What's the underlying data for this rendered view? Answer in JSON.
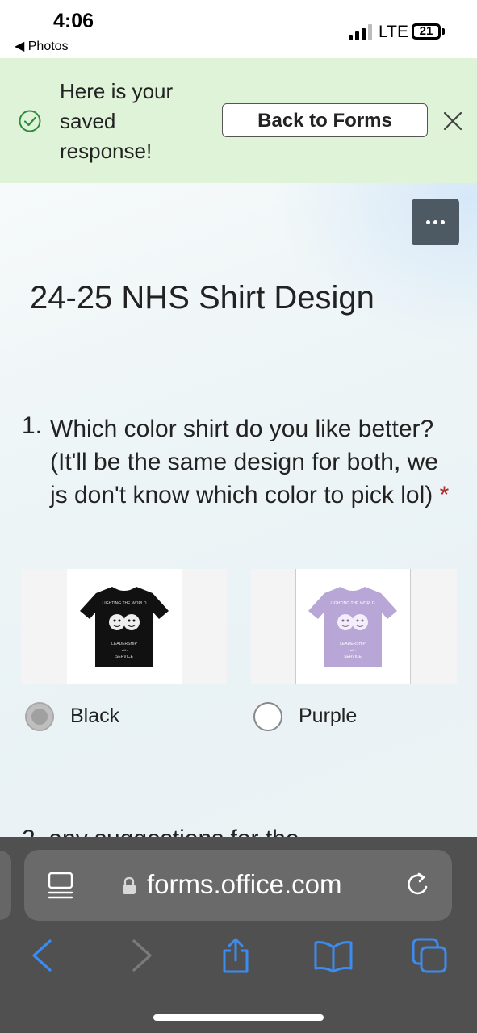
{
  "status_bar": {
    "time": "4:06",
    "back_app": "◀ Photos",
    "network": "LTE",
    "battery": "21"
  },
  "banner": {
    "message": "Here is your saved response!",
    "back_button": "Back to Forms",
    "colors": {
      "background": "#dff3d8",
      "check": "#2e8b3e"
    }
  },
  "form": {
    "title": "24-25 NHS Shirt Design",
    "question1": {
      "number": "1.",
      "text": "Which color shirt do you like better? (It'll be the same design for both, we js don't know which color to pick lol)",
      "required_mark": "*",
      "choices": [
        {
          "label": "Black",
          "selected": true,
          "shirt_color": "#111111"
        },
        {
          "label": "Purple",
          "selected": false,
          "shirt_color": "#b7a6d6"
        }
      ]
    },
    "question2_partial": "2. any suggestions for the"
  },
  "browser": {
    "url": "forms.office.com",
    "accent": "#3b8cf0"
  }
}
